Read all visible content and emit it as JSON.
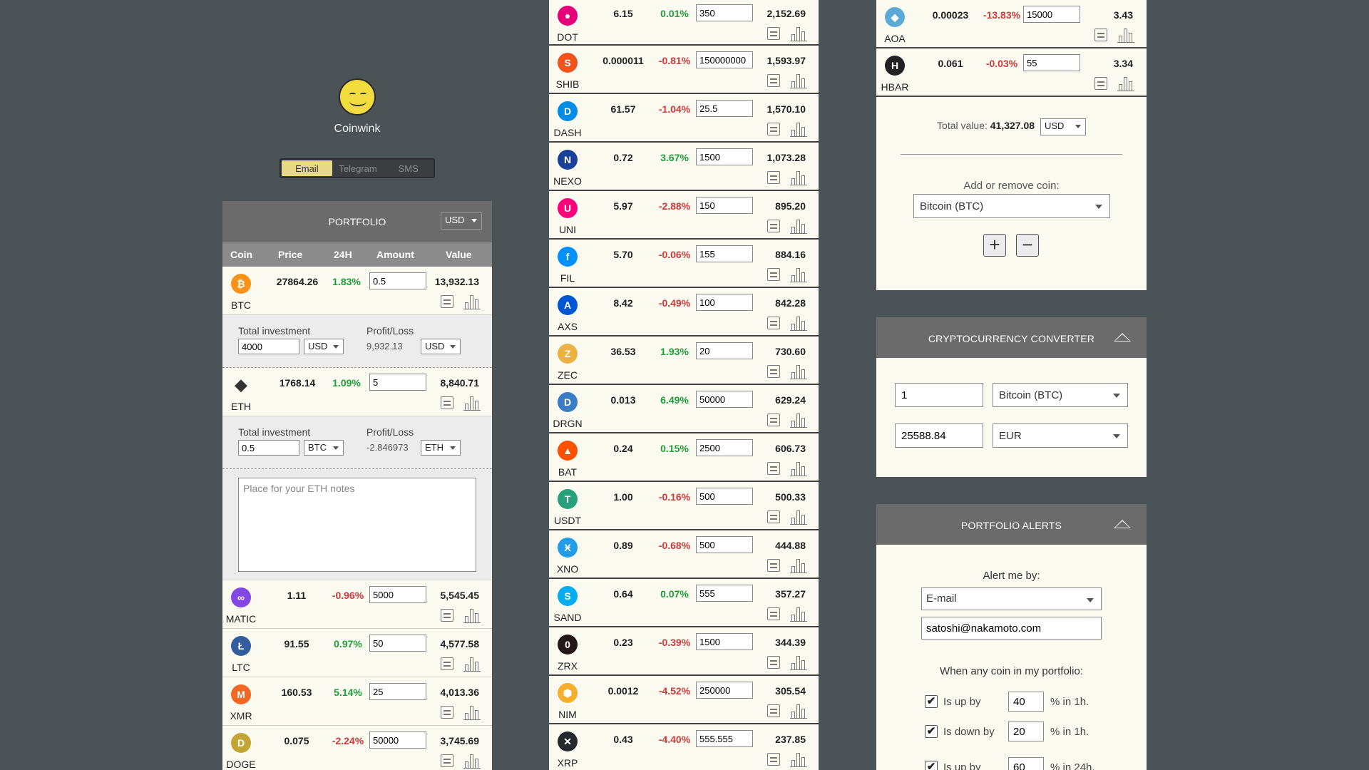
{
  "brand": {
    "name": "Coinwink"
  },
  "tabs": [
    "Email",
    "Telegram",
    "SMS"
  ],
  "portfolio": {
    "title": "PORTFOLIO",
    "currency": "USD",
    "columns": [
      "Coin",
      "Price",
      "24H",
      "Amount",
      "Value"
    ],
    "btc": {
      "symbol": "BTC",
      "price": "27864.26",
      "change": "1.83%",
      "amount": "0.5",
      "value": "13,932.13",
      "color": "#f7931a",
      "glyph": "₿"
    },
    "btc_invest": {
      "total_label": "Total investment",
      "total_value": "4000",
      "total_cur": "USD",
      "pl_label": "Profit/Loss",
      "pl_value": "9,932.13",
      "pl_cur": "USD"
    },
    "eth": {
      "symbol": "ETH",
      "price": "1768.14",
      "change": "1.09%",
      "amount": "5",
      "value": "8,840.71"
    },
    "eth_invest": {
      "total_label": "Total investment",
      "total_value": "0.5",
      "total_cur": "BTC",
      "pl_label": "Profit/Loss",
      "pl_value": "-2.846973",
      "pl_cur": "ETH"
    },
    "eth_notes_placeholder": "Place for your ETH notes",
    "rows": [
      {
        "symbol": "MATIC",
        "price": "1.11",
        "change": "-0.96%",
        "dir": "down",
        "amount": "5000",
        "value": "5,545.45",
        "color": "#8247e5",
        "glyph": "∞"
      },
      {
        "symbol": "LTC",
        "price": "91.55",
        "change": "0.97%",
        "dir": "up",
        "amount": "50",
        "value": "4,577.58",
        "color": "#345d9d",
        "glyph": "Ł"
      },
      {
        "symbol": "XMR",
        "price": "160.53",
        "change": "5.14%",
        "dir": "up",
        "amount": "25",
        "value": "4,013.36",
        "color": "#f26822",
        "glyph": "M"
      },
      {
        "symbol": "DOGE",
        "price": "0.075",
        "change": "-2.24%",
        "dir": "down",
        "amount": "50000",
        "value": "3,745.69",
        "color": "#c2a633",
        "glyph": "D"
      }
    ]
  },
  "middle_rows": [
    {
      "symbol": "DOT",
      "price": "6.15",
      "change": "0.01%",
      "dir": "up",
      "amount": "350",
      "value": "2,152.69",
      "color": "#e6007a",
      "glyph": "●"
    },
    {
      "symbol": "SHIB",
      "price": "0.000011",
      "change": "-0.81%",
      "dir": "down",
      "amount": "150000000",
      "value": "1,593.97",
      "color": "#f0531c",
      "glyph": "S"
    },
    {
      "symbol": "DASH",
      "price": "61.57",
      "change": "-1.04%",
      "dir": "down",
      "amount": "25.5",
      "value": "1,570.10",
      "color": "#008ce7",
      "glyph": "D"
    },
    {
      "symbol": "NEXO",
      "price": "0.72",
      "change": "3.67%",
      "dir": "up",
      "amount": "1500",
      "value": "1,073.28",
      "color": "#1a4199",
      "glyph": "N"
    },
    {
      "symbol": "UNI",
      "price": "5.97",
      "change": "-2.88%",
      "dir": "down",
      "amount": "150",
      "value": "895.20",
      "color": "#ff007a",
      "glyph": "U"
    },
    {
      "symbol": "FIL",
      "price": "5.70",
      "change": "-0.06%",
      "dir": "down",
      "amount": "155",
      "value": "884.16",
      "color": "#0090ff",
      "glyph": "f"
    },
    {
      "symbol": "AXS",
      "price": "8.42",
      "change": "-0.49%",
      "dir": "down",
      "amount": "100",
      "value": "842.28",
      "color": "#0055d5",
      "glyph": "A"
    },
    {
      "symbol": "ZEC",
      "price": "36.53",
      "change": "1.93%",
      "dir": "up",
      "amount": "20",
      "value": "730.60",
      "color": "#ecb244",
      "glyph": "Z"
    },
    {
      "symbol": "DRGN",
      "price": "0.013",
      "change": "6.49%",
      "dir": "up",
      "amount": "50000",
      "value": "629.24",
      "color": "#3b7dc4",
      "glyph": "D"
    },
    {
      "symbol": "BAT",
      "price": "0.24",
      "change": "0.15%",
      "dir": "up",
      "amount": "2500",
      "value": "606.73",
      "color": "#ff5000",
      "glyph": "▲"
    },
    {
      "symbol": "USDT",
      "price": "1.00",
      "change": "-0.16%",
      "dir": "down",
      "amount": "500",
      "value": "500.33",
      "color": "#26a17b",
      "glyph": "T"
    },
    {
      "symbol": "XNO",
      "price": "0.89",
      "change": "-0.68%",
      "dir": "down",
      "amount": "500",
      "value": "444.88",
      "color": "#209ce9",
      "glyph": "Ӿ"
    },
    {
      "symbol": "SAND",
      "price": "0.64",
      "change": "0.07%",
      "dir": "up",
      "amount": "555",
      "value": "357.27",
      "color": "#04adef",
      "glyph": "S"
    },
    {
      "symbol": "ZRX",
      "price": "0.23",
      "change": "-0.39%",
      "dir": "down",
      "amount": "1500",
      "value": "344.39",
      "color": "#231815",
      "glyph": "0"
    },
    {
      "symbol": "NIM",
      "price": "0.0012",
      "change": "-4.52%",
      "dir": "down",
      "amount": "250000",
      "value": "305.54",
      "color": "#f6ae2d",
      "glyph": "⬢"
    },
    {
      "symbol": "XRP",
      "price": "0.43",
      "change": "-4.40%",
      "dir": "down",
      "amount": "555.555",
      "value": "237.85",
      "color": "#23292f",
      "glyph": "✕"
    }
  ],
  "right_rows": [
    {
      "symbol": "AOA",
      "price": "0.00023",
      "change": "-13.83%",
      "dir": "down",
      "amount": "15000",
      "value": "3.43",
      "color": "#5aa9d6",
      "glyph": "◆"
    },
    {
      "symbol": "HBAR",
      "price": "0.061",
      "change": "-0.03%",
      "dir": "down",
      "amount": "55",
      "value": "3.34",
      "color": "#222222",
      "glyph": "H"
    }
  ],
  "totals": {
    "label": "Total value:",
    "value": "41,327.08",
    "currency": "USD"
  },
  "add_remove": {
    "label": "Add or remove coin:",
    "selected": "Bitcoin (BTC)",
    "plus": "+",
    "minus": "−"
  },
  "converter": {
    "title": "CRYPTOCURRENCY CONVERTER",
    "amount": "1",
    "from": "Bitcoin (BTC)",
    "result": "25588.84",
    "to": "EUR"
  },
  "alerts": {
    "title": "PORTFOLIO ALERTS",
    "alert_by_label": "Alert me by:",
    "method": "E-mail",
    "email": "satoshi@nakamoto.com",
    "when_label": "When any coin in my portfolio:",
    "conditions": [
      {
        "checked": "✔",
        "label": "Is up by",
        "value": "40",
        "suffix": "% in 1h."
      },
      {
        "checked": "✔",
        "label": "Is down by",
        "value": "20",
        "suffix": "% in 1h."
      },
      {
        "checked": "✔",
        "label": "Is up by",
        "value": "60",
        "suffix": "% in 24h."
      }
    ]
  }
}
